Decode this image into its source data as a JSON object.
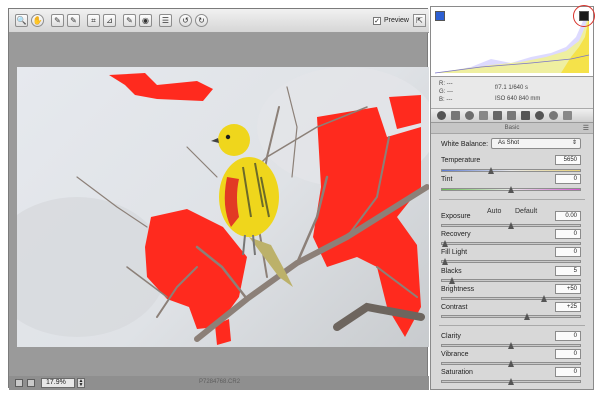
{
  "toolbar": {
    "tools": [
      {
        "icon": "zoom-icon",
        "glyph": "🔍"
      },
      {
        "icon": "hand-icon",
        "glyph": "✋"
      },
      {
        "icon": "white-balance-icon",
        "glyph": "✎"
      },
      {
        "icon": "color-sampler-icon",
        "glyph": "✎"
      },
      {
        "icon": "crop-icon",
        "glyph": "⌗"
      },
      {
        "icon": "straighten-icon",
        "glyph": "⊿"
      },
      {
        "icon": "retouch-icon",
        "glyph": "✎"
      },
      {
        "icon": "red-eye-icon",
        "glyph": "◉"
      },
      {
        "icon": "preferences-icon",
        "glyph": "☰"
      },
      {
        "icon": "rotate-left-icon",
        "glyph": "↺"
      },
      {
        "icon": "rotate-right-icon",
        "glyph": "↻"
      }
    ],
    "preview_label": "Preview",
    "preview_checked": true,
    "fullscreen_glyph": "⇱"
  },
  "statusbar": {
    "zoom_value": "17.9%",
    "filename": "P7284768.CR2"
  },
  "readout": {
    "r": "R: ---",
    "g": "G: ---",
    "b": "B: ---",
    "camera_line1": "f/7.1    1/640 s",
    "camera_line2": "ISO 640    840 mm"
  },
  "panel": {
    "title": "Basic",
    "menu_glyph": "☰"
  },
  "white_balance": {
    "label": "White Balance:",
    "value": "As Shot"
  },
  "sliders": {
    "temperature": {
      "label": "Temperature",
      "value": "5650",
      "level": 0.35
    },
    "tint": {
      "label": "Tint",
      "value": "0",
      "level": 0.5
    },
    "exposure": {
      "label": "Exposure",
      "value": "0.00",
      "level": 0.5
    },
    "recovery": {
      "label": "Recovery",
      "value": "0",
      "level": 0.0
    },
    "fill_light": {
      "label": "Fill Light",
      "value": "0",
      "level": 0.0
    },
    "blacks": {
      "label": "Blacks",
      "value": "5",
      "level": 0.05
    },
    "brightness": {
      "label": "Brightness",
      "value": "+50",
      "level": 0.75
    },
    "contrast": {
      "label": "Contrast",
      "value": "+25",
      "level": 0.62
    },
    "clarity": {
      "label": "Clarity",
      "value": "0",
      "level": 0.5
    },
    "vibrance": {
      "label": "Vibrance",
      "value": "0",
      "level": 0.5
    },
    "saturation": {
      "label": "Saturation",
      "value": "0",
      "level": 0.5
    }
  },
  "auto_label": "Auto",
  "default_label": "Default",
  "colors": {
    "clipping_overlay": "#ff2a1e",
    "bird_yellow": "#efd61c",
    "bird_red": "#e23a24",
    "panel_bg": "#d8d8d8",
    "highlight_ring": "#d9322b"
  }
}
